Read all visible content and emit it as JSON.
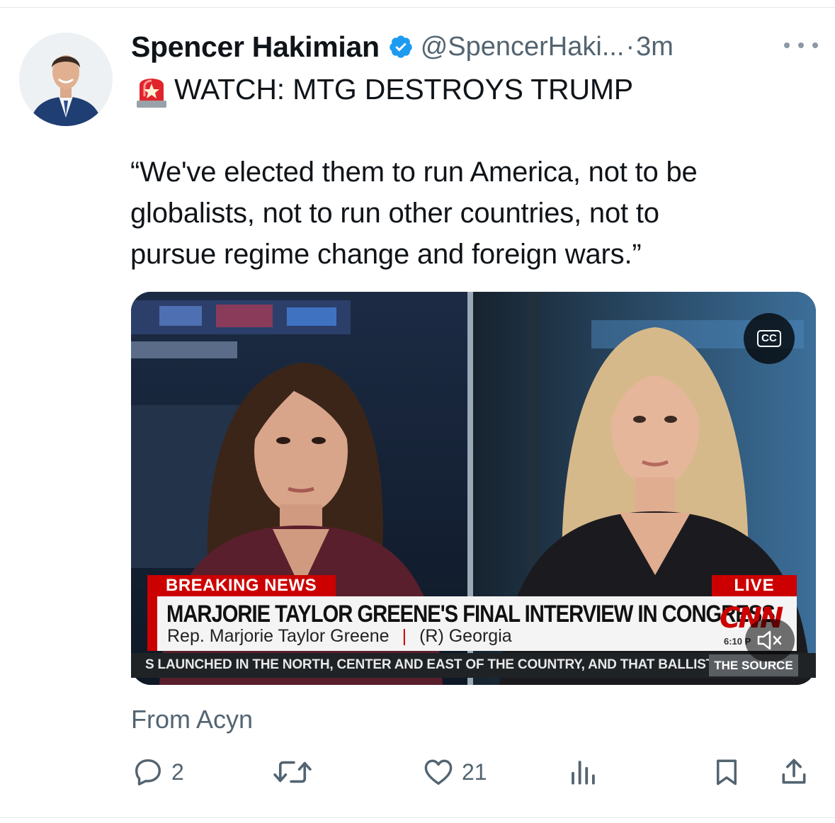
{
  "tweet": {
    "author_name": "Spencer Hakimian",
    "handle": "@SpencerHaki...",
    "separator": "·",
    "time": "3m",
    "headline": "WATCH: MTG DESTROYS TRUMP",
    "quote_lines": [
      "“We've elected them to run America, not to be",
      "globalists, not to run other countries, not to",
      "pursue regime change and foreign wars.”"
    ],
    "attribution": "From Acyn"
  },
  "video": {
    "cc_label": "CC",
    "breaking": "BREAKING NEWS",
    "live": "LIVE",
    "headline": "MARJORIE TAYLOR GREENE'S FINAL INTERVIEW IN CONGRESS",
    "subline_name": "Rep. Marjorie Taylor Greene",
    "subline_sep": "|",
    "subline_party": "(R) Georgia",
    "network": "CNN",
    "time_fragment": "6:10 P",
    "ticker": "S LAUNCHED IN THE NORTH, CENTER AND EAST OF THE COUNTRY, AND THAT BALLISTI",
    "show_name": "THE SOURCE"
  },
  "actions": {
    "replies": "2",
    "likes": "21"
  },
  "colors": {
    "text": "#0f1419",
    "secondary": "#536471",
    "verified": "#1d9bf0",
    "cnn_red": "#cc0000"
  },
  "icons": [
    "siren-icon",
    "verified-badge-icon",
    "more-icon",
    "cc-icon",
    "mute-icon",
    "reply-icon",
    "retweet-icon",
    "like-icon",
    "views-icon",
    "bookmark-icon",
    "share-icon"
  ]
}
